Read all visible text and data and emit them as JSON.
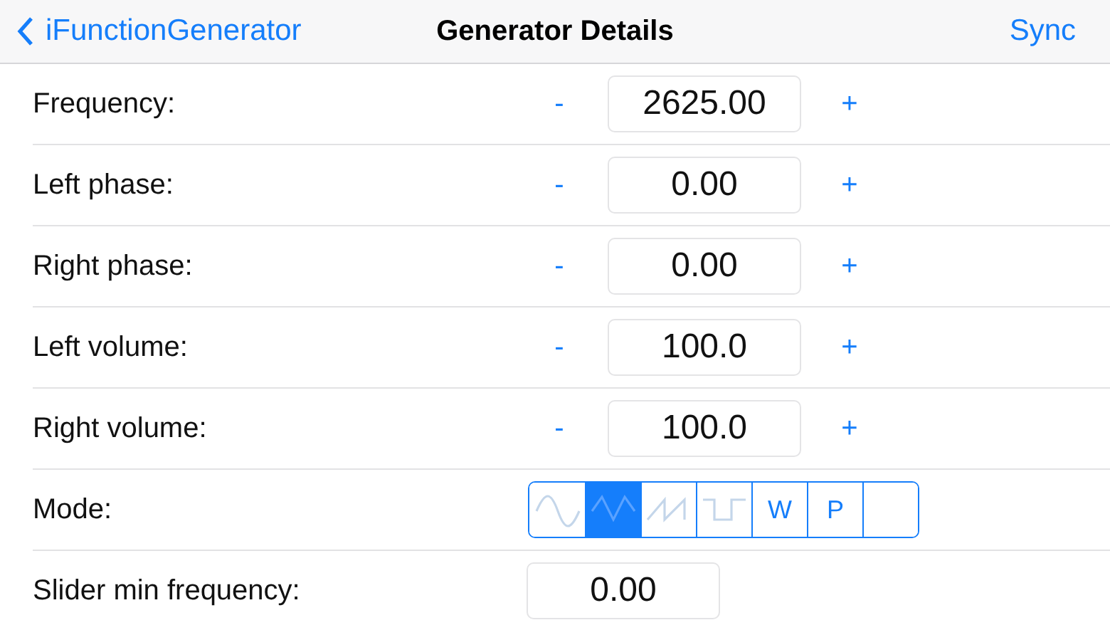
{
  "nav": {
    "back": "iFunctionGenerator",
    "title": "Generator Details",
    "action": "Sync"
  },
  "rows": [
    {
      "kind": "stepper",
      "label": "Frequency:",
      "minus": "-",
      "value": "2625.00",
      "plus": "+"
    },
    {
      "kind": "stepper",
      "label": "Left phase:",
      "minus": "-",
      "value": "0.00",
      "plus": "+"
    },
    {
      "kind": "stepper",
      "label": "Right phase:",
      "minus": "-",
      "value": "0.00",
      "plus": "+"
    },
    {
      "kind": "stepper",
      "label": "Left volume:",
      "minus": "-",
      "value": "100.0",
      "plus": "+"
    },
    {
      "kind": "stepper",
      "label": "Right volume:",
      "minus": "-",
      "value": "100.0",
      "plus": "+"
    },
    {
      "kind": "segments",
      "label": "Mode:",
      "segments": [
        {
          "kind": "sine",
          "selected": false
        },
        {
          "kind": "triangle",
          "selected": true
        },
        {
          "kind": "sawtooth",
          "selected": false
        },
        {
          "kind": "square",
          "selected": false
        },
        {
          "kind": "text",
          "text": "W",
          "selected": false
        },
        {
          "kind": "text",
          "text": "P",
          "selected": false
        },
        {
          "kind": "blank",
          "selected": false
        }
      ]
    },
    {
      "kind": "field",
      "label": "Slider min frequency:",
      "value": "0.00"
    }
  ]
}
